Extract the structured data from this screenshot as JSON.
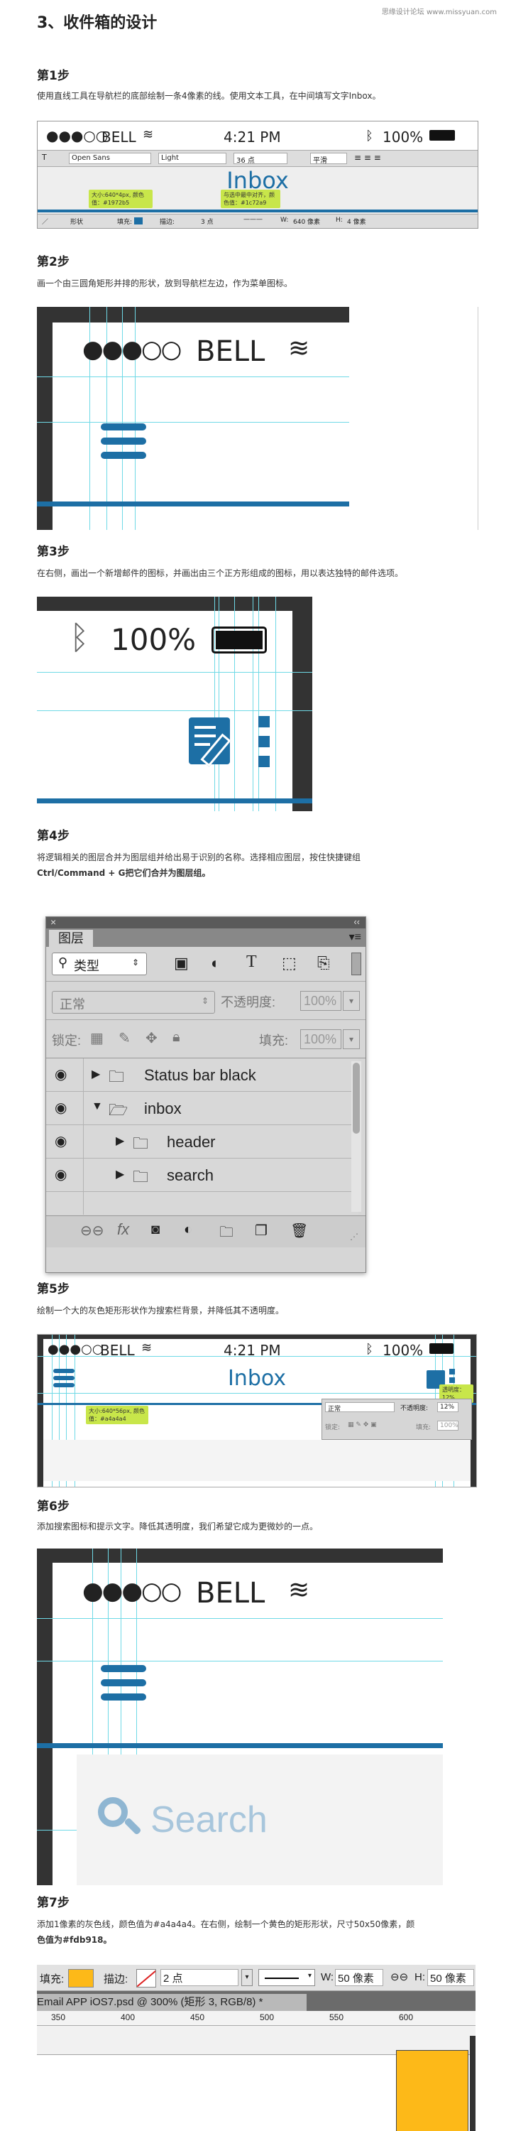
{
  "header": {
    "title": "3、收件箱的设计",
    "watermark": "思缘设计论坛 www.missyuan.com"
  },
  "steps": [
    {
      "title": "第1步",
      "desc": "使用直线工具在导航栏的底部绘制一条4像素的线。使用文本工具，在中间填写文字Inbox。"
    },
    {
      "title": "第2步",
      "desc": "画一个由三圆角矩形并排的形状，放到导航栏左边，作为菜单图标。"
    },
    {
      "title": "第3步",
      "desc": "在右侧，画出一个新增邮件的图标，并画出由三个正方形组成的图标，用以表达独特的邮件选项。"
    },
    {
      "title": "第4步",
      "desc1": "将逻辑相关的图层合并为图层组并给出易于识别的名称。选择相应图层，按住快捷键组",
      "desc2": "Ctrl/Command + G把它们合并为图层组。"
    },
    {
      "title": "第5步",
      "desc": "绘制一个大的灰色矩形形状作为搜索栏背景，并降低其不透明度。"
    },
    {
      "title": "第6步",
      "desc": "添加搜索图标和提示文字。降低其透明度，我们希望它成为更微妙的一点。"
    },
    {
      "title": "第7步",
      "desc1": "添加1像素的灰色线，颜色值为#a4a4a4。在右侧，绘制一个黄色的矩形形状，尺寸50x50像素，颜",
      "desc2": "色值为#fdb918。"
    }
  ],
  "statusbar": {
    "carrier": "BELL",
    "time": "4:21 PM",
    "battery": "100%",
    "signal": "●●●○○"
  },
  "nav": {
    "title": "Inbox"
  },
  "ps_toolbar1": {
    "font": "Open Sans",
    "weight": "Light",
    "size": "36 点",
    "aa": "平滑",
    "tip1": "大小:640*4px, 颜色值：#1972b5",
    "tip2": "与选中最中对齐，颜色值：#1c72a9",
    "shape": "形状",
    "fill_label": "填充:",
    "stroke_label": "描边:",
    "stroke_size": "3 点",
    "w_label": "W:",
    "w_value": "640 像素",
    "h_label": "H:",
    "h_value": "4 像素"
  },
  "layers_panel": {
    "tab": "图层",
    "filter": "类型",
    "blend": "正常",
    "opacity_label": "不透明度:",
    "opacity_value": "100%",
    "lock_label": "锁定:",
    "fill_label": "填充:",
    "fill_value": "100%",
    "rows": [
      {
        "name": "Status bar black"
      },
      {
        "name": "inbox"
      },
      {
        "name": "header"
      },
      {
        "name": "search"
      }
    ]
  },
  "step5": {
    "tip": "大小:640*56px, 颜色值：#a4a4a4",
    "opacity_label": "不透明度:",
    "opacity_value": "12%",
    "opacity_tip": "透明度：12%",
    "blend": "正常",
    "fill_label": "填充:",
    "fill_value": "100%",
    "lock_label": "锁定:"
  },
  "step6": {
    "search_placeholder": "Search"
  },
  "step7": {
    "fill_label": "填充:",
    "stroke_label": "描边:",
    "stroke_size": "2 点",
    "w_label": "W:",
    "w_value": "50 像素",
    "h_label": "H:",
    "h_value": "50 像素",
    "doc_tab": "Email APP iOS7.psd @ 300% (矩形 3, RGB/8) *",
    "ruler": [
      "350",
      "400",
      "450",
      "500",
      "550",
      "600"
    ],
    "yellow": "#fdb918"
  },
  "colors": {
    "blue": "#1d6fa5",
    "guide": "#6fd9e6",
    "yellow": "#fdb918",
    "frame": "#333333"
  }
}
